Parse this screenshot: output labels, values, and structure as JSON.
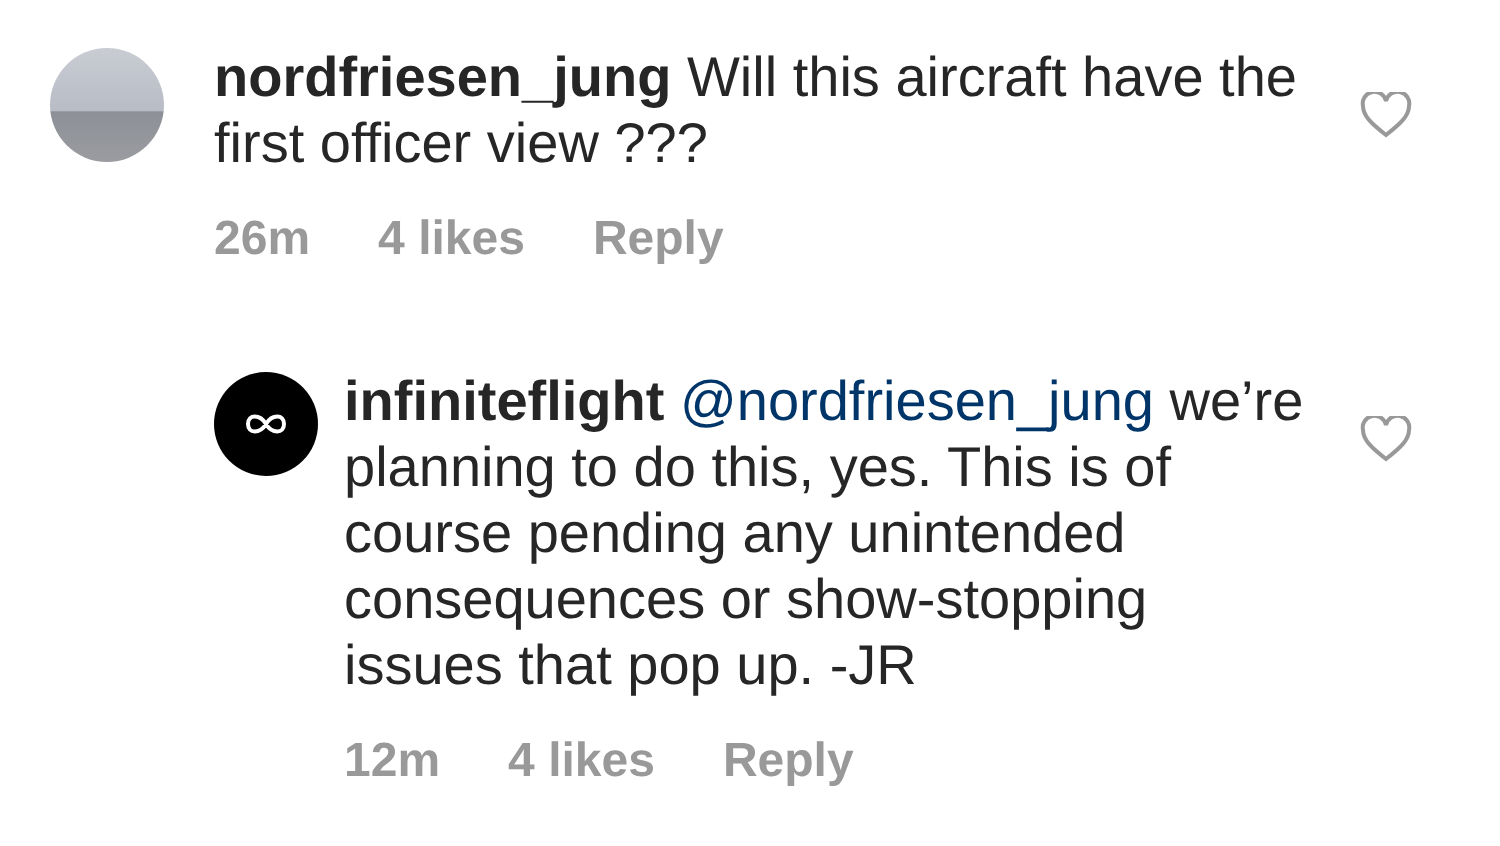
{
  "comments": [
    {
      "kind": "comment",
      "username": "nordfriesen_jung",
      "text": "Will this aircraft have the first officer view ???",
      "time": "26m",
      "likes": "4 likes",
      "reply": "Reply",
      "liked": false
    },
    {
      "kind": "reply",
      "username": "infiniteflight",
      "mention": "@nordfriesen_jung",
      "text": "we’re planning to do this, yes. This is of course pending any unintended consequences or show-stopping issues that pop up. -JR",
      "time": "12m",
      "likes": "4 likes",
      "reply": "Reply",
      "liked": false
    }
  ]
}
